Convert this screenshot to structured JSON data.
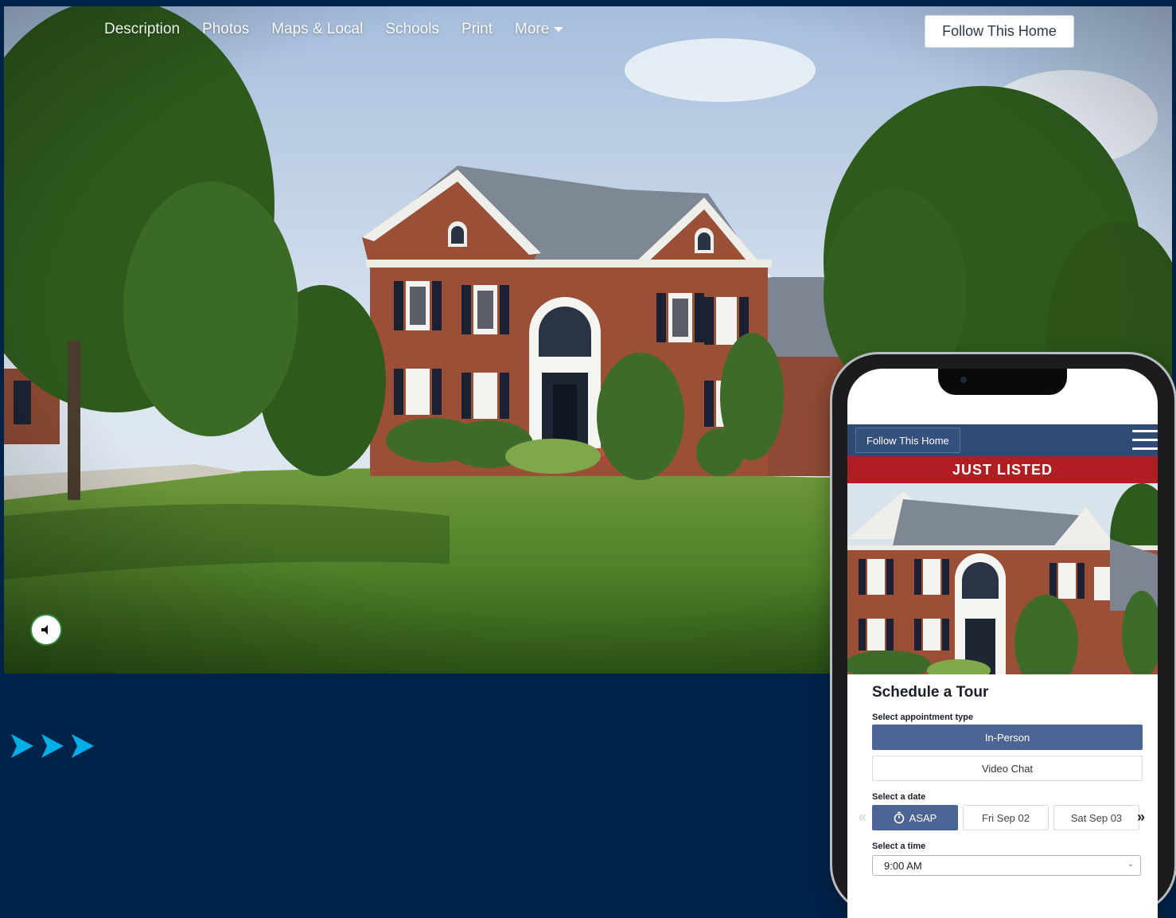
{
  "nav": {
    "links": [
      "Description",
      "Photos",
      "Maps & Local",
      "Schools",
      "Print",
      "More"
    ],
    "follow_label": "Follow This Home"
  },
  "hero": {
    "sound_icon": "speaker-icon"
  },
  "phone": {
    "follow_label": "Follow This Home",
    "menu_icon": "hamburger-icon",
    "banner": "JUST LISTED",
    "tour": {
      "title": "Schedule a Tour",
      "appt_label": "Select appointment type",
      "appt_options": [
        "In-Person",
        "Video Chat"
      ],
      "date_label": "Select a date",
      "dates": [
        "ASAP",
        "Fri Sep 02",
        "Sat Sep 03"
      ],
      "time_label": "Select a time",
      "time_value": "9:00 AM"
    }
  },
  "colors": {
    "page_bg": "#00234a",
    "accent_arrow": "#00aee8",
    "listed_red": "#b01e24",
    "mobile_bar": "#2f4a74",
    "selected_btn": "#4d6594"
  }
}
